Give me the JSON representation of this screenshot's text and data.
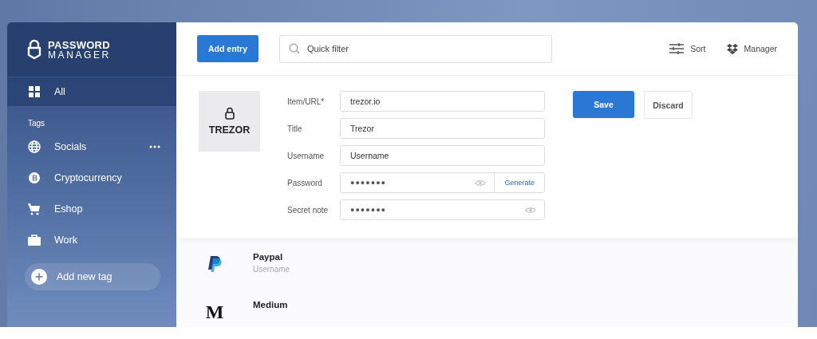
{
  "brand": {
    "line_1": "PASSWORD",
    "line_2": "MANAGER"
  },
  "sidebar": {
    "all": {
      "label": "All",
      "selected": true
    },
    "tags_heading": "Tags",
    "tags": [
      {
        "kind": "globe",
        "label": "Socials",
        "selected": false,
        "menu": true
      },
      {
        "kind": "coin",
        "label": "Cryptocurrency",
        "selected": false,
        "menu": false
      },
      {
        "kind": "cart",
        "label": "Eshop",
        "selected": false,
        "menu": false
      },
      {
        "kind": "briefcase",
        "label": "Work",
        "selected": false,
        "menu": false
      }
    ],
    "add_tag": "Add new tag"
  },
  "toolbar": {
    "add_entry": "Add entry",
    "search": {
      "placeholder": "Quick filter"
    },
    "sort": "Sort",
    "manager": "Manager"
  },
  "editor": {
    "logo_text": "TREZOR",
    "fields": [
      {
        "kind": "text",
        "label": "Item/URL*",
        "value": "trezor.io"
      },
      {
        "kind": "text",
        "label": "Title",
        "value": "Trezor"
      },
      {
        "kind": "text",
        "label": "Username",
        "value": "Username"
      },
      {
        "kind": "secret",
        "label": "Password",
        "value": "●●●●●●●",
        "generate": "Generate"
      },
      {
        "kind": "secret",
        "label": "Secret note",
        "value": "●●●●●●●"
      }
    ],
    "save": "Save",
    "discard": "Discard"
  },
  "entries": [
    {
      "kind": "paypal",
      "title": "Paypal",
      "subtitle": "Username"
    },
    {
      "kind": "letter",
      "logo_text": "M",
      "title": "Medium"
    }
  ]
}
